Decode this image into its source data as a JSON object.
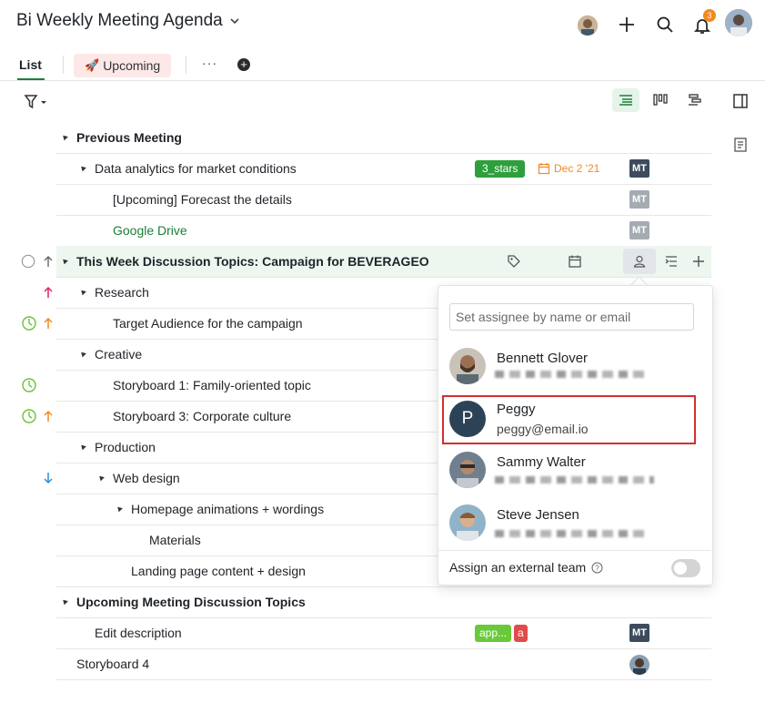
{
  "header": {
    "title": "Bi Weekly Meeting Agenda",
    "notification_count": "3"
  },
  "tabs": {
    "list_label": "List",
    "upcoming_label": "Upcoming",
    "more_label": "···"
  },
  "rows": [
    {
      "text": "Previous Meeting",
      "bold": true
    },
    {
      "text": "Data analytics for market conditions",
      "tag": "3_stars",
      "date": "Dec 2 '21",
      "assignee": "MT"
    },
    {
      "text": "[Upcoming] Forecast the details",
      "assignee": "MT"
    },
    {
      "text": "Google Drive",
      "assignee": "MT"
    },
    {
      "text": "This Week Discussion Topics: Campaign for BEVERAGEO",
      "bold": true
    },
    {
      "text": "Research"
    },
    {
      "text": "Target Audience for the campaign"
    },
    {
      "text": "Creative"
    },
    {
      "text": "Storyboard 1: Family-oriented topic"
    },
    {
      "text": "Storyboard 3: Corporate culture"
    },
    {
      "text": "Production"
    },
    {
      "text": "Web design"
    },
    {
      "text": "Homepage animations + wordings"
    },
    {
      "text": "Materials"
    },
    {
      "text": "Landing page content + design"
    },
    {
      "text": "Upcoming Meeting Discussion Topics",
      "bold": true
    },
    {
      "text": "Edit description",
      "tags": [
        "app...",
        "a"
      ],
      "assignee": "MT"
    },
    {
      "text": "Storyboard 4"
    }
  ],
  "assignee_popover": {
    "search_placeholder": "Set assignee by name or email",
    "people": [
      {
        "name": "Bennett Glover",
        "email_blurred": true
      },
      {
        "name": "Peggy",
        "email": "peggy@email.io",
        "initial": "P",
        "selected": true
      },
      {
        "name": "Sammy Walter",
        "email_blurred": true
      },
      {
        "name": "Steve Jensen",
        "email_blurred": true
      }
    ],
    "external_team_label": "Assign an external team",
    "external_team_enabled": false
  },
  "colors": {
    "accent_green": "#1a7f37",
    "tag_green": "#2e9f3c",
    "date_orange": "#f08a24",
    "assignee_dark": "#3d4b5c",
    "highlight_red": "#d32f2f",
    "priority_up_red": "#e0245e",
    "priority_down_blue": "#2a8fd6"
  }
}
